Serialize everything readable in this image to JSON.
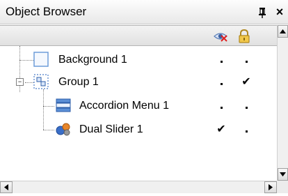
{
  "panel": {
    "title": "Object Browser",
    "pin_icon": "pin-icon",
    "close_glyph": "×"
  },
  "columns": {
    "visibility_icon": "eye-hidden-icon",
    "lock_icon": "padlock-icon"
  },
  "tree": {
    "items": [
      {
        "label": "Background 1",
        "icon": "background-object-icon",
        "visible_mark": "dot",
        "lock_mark": "dot",
        "depth": 0,
        "expandable": false
      },
      {
        "label": "Group 1",
        "icon": "group-icon",
        "visible_mark": "dot",
        "lock_mark": "check",
        "depth": 0,
        "expandable": true,
        "expanded": true,
        "expander_glyph": "−"
      },
      {
        "label": "Accordion Menu 1",
        "icon": "accordion-menu-icon",
        "visible_mark": "dot",
        "lock_mark": "dot",
        "depth": 1,
        "expandable": false
      },
      {
        "label": "Dual Slider 1",
        "icon": "dual-slider-icon",
        "visible_mark": "check",
        "lock_mark": "dot",
        "depth": 1,
        "expandable": false
      }
    ],
    "check_glyph": "✔"
  },
  "scrollbars": {
    "up_glyph": "▲",
    "down_glyph": "▼",
    "left_glyph": "◀",
    "right_glyph": "▶"
  }
}
